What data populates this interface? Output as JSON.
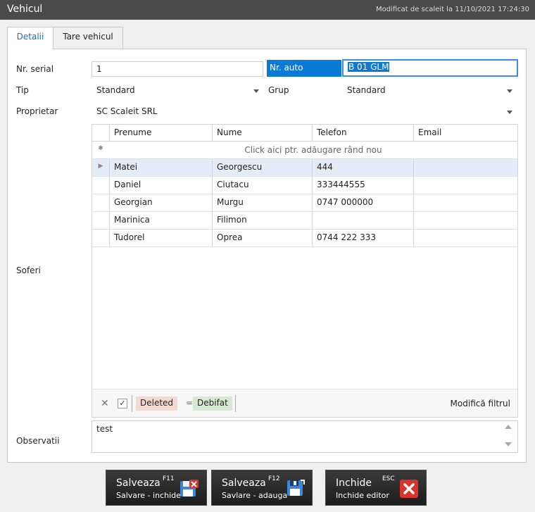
{
  "window": {
    "title": "Vehicul",
    "modified": "Modificat de scaleit la 11/10/2021 17:24:30"
  },
  "tabs": [
    {
      "label": "Detalii",
      "active": true
    },
    {
      "label": "Tare vehicul",
      "active": false
    }
  ],
  "form": {
    "serial_label": "Nr. serial",
    "serial_value": "1",
    "auto_label": "Nr. auto",
    "auto_value": "B 01 GLM",
    "tip_label": "Tip",
    "tip_value": "Standard",
    "grup_label": "Grup",
    "grup_value": "Standard",
    "proprietar_label": "Proprietar",
    "proprietar_value": "SC Scaleit SRL",
    "soferi_label": "Soferi",
    "observatii_label": "Observatii",
    "observatii_value": "test"
  },
  "grid": {
    "columns": [
      "Prenume",
      "Nume",
      "Telefon",
      "Email"
    ],
    "new_row_text": "Click aici ptr. adăugare rând nou",
    "rows": [
      {
        "prenume": "Matei",
        "nume": "Georgescu",
        "telefon": "444",
        "email": ""
      },
      {
        "prenume": "Daniel",
        "nume": "Ciutacu",
        "telefon": "333444555",
        "email": ""
      },
      {
        "prenume": "Georgian",
        "nume": "Murgu",
        "telefon": "0747 000000",
        "email": ""
      },
      {
        "prenume": "Marinica",
        "nume": "Filimon",
        "telefon": "",
        "email": ""
      },
      {
        "prenume": "Tudorel",
        "nume": "Oprea",
        "telefon": "0744 222 333",
        "email": ""
      }
    ],
    "filter": {
      "field": "Deleted",
      "operator": "=",
      "value": "Debifat",
      "edit_label": "Modifică filtrul"
    }
  },
  "buttons": [
    {
      "main": "Salveaza",
      "key": "F11",
      "sub": "Salvare - inchide",
      "icon": "save-close-icon"
    },
    {
      "main": "Salveaza",
      "key": "F12",
      "sub": "Savlare - adauga",
      "icon": "save-add-icon"
    },
    {
      "main": "Inchide",
      "key": "ESC",
      "sub": "Inchide editor",
      "icon": "close-icon"
    }
  ]
}
